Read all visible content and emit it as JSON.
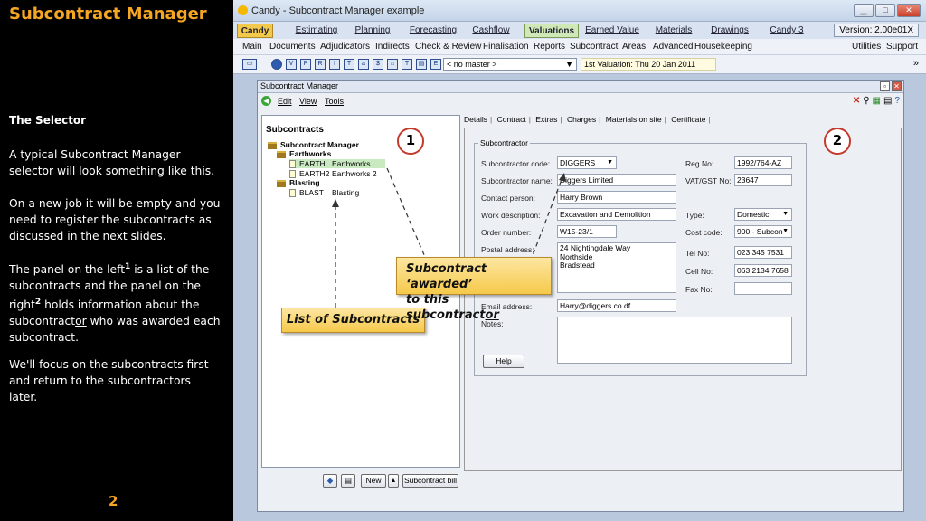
{
  "slide": {
    "title": "Subcontract Manager",
    "heading": "The Selector",
    "p1": "A typical Subcontract Manager selector will look something like this.",
    "p2": "On a new job it will be empty and you need to register the subcontracts as discussed in the next slides.",
    "p3_a": "The panel on the left",
    "p3_sup1": "1",
    "p3_b": " is a list of the subcontracts and the panel on the right",
    "p3_sup2": "2",
    "p3_c": " holds information about the subcontract",
    "p3_or": "or",
    "p3_d": " who was awarded each subcontract.",
    "p4": "We'll focus on the subcontracts first and return to the subcontractors later.",
    "page_number": "2"
  },
  "app": {
    "window_title": "Candy - Subcontract Manager example",
    "modules": [
      "Candy",
      "Estimating",
      "Planning",
      "Forecasting",
      "Cashflow",
      "Valuations",
      "Earned Value",
      "Materials",
      "Drawings",
      "Candy 3"
    ],
    "active_module": "Valuations",
    "version": "Version: 2.00e01X",
    "menu": [
      "Main",
      "Documents",
      "Adjudicators",
      "Indirects",
      "Check & Review",
      "Finalisation",
      "Reports",
      "Subcontract",
      "Areas",
      "Advanced",
      "Housekeeping"
    ],
    "menu_right": [
      "Utilities",
      "Support"
    ],
    "master_select": "< no master >",
    "valuation": "1st Valuation: Thu 20 Jan 2011"
  },
  "inner": {
    "title": "Subcontract Manager",
    "menu": [
      "Edit",
      "View",
      "Tools"
    ],
    "list_title": "Subcontracts",
    "tree": {
      "root": "Subcontract Manager",
      "group1": "Earthworks",
      "items1": [
        {
          "code": "EARTH",
          "name": "Earthworks"
        },
        {
          "code": "EARTH2",
          "name": "Earthworks 2"
        }
      ],
      "group2": "Blasting",
      "items2": [
        {
          "code": "BLAST",
          "name": "Blasting"
        }
      ]
    },
    "buttons": {
      "new": "New",
      "bill": "Subcontract bill"
    },
    "tabs": [
      "Details",
      "Contract",
      "Extras",
      "Charges",
      "Materials on site",
      "Certificate"
    ],
    "group_label": "Subcontractor",
    "fields": {
      "code_label": "Subcontractor code:",
      "code": "DIGGERS",
      "name_label": "Subcontractor name:",
      "name": "Diggers Limited",
      "contact_label": "Contact person:",
      "contact": "Harry Brown",
      "work_label": "Work description:",
      "work": "Excavation and Demolition",
      "order_label": "Order number:",
      "order": "W15-23/1",
      "postal_label": "Postal address:",
      "postal1": "24 Nightingdale Way",
      "postal2": "Northside",
      "postal3": "Bradstead",
      "email_label": "Email address:",
      "email": "Harry@diggers.co.df",
      "notes_label": "Notes:",
      "reg_label": "Reg No:",
      "reg": "1992/764-AZ",
      "vat_label": "VAT/GST No:",
      "vat": "23647",
      "type_label": "Type:",
      "type": "Domestic",
      "cost_label": "Cost code:",
      "cost": "900 - Subcon",
      "tel_label": "Tel No:",
      "tel": "023 345 7531",
      "cell_label": "Cell No:",
      "cell": "063 2134 7658",
      "fax_label": "Fax No:",
      "fax": "",
      "help": "Help"
    }
  },
  "annotations": {
    "circle1": "1",
    "circle2": "2",
    "callout_list": "List of Subcontracts",
    "callout_awarded_1": "Subcontract ‘awarded’",
    "callout_awarded_2a": "to this subcontract",
    "callout_awarded_2b": "or"
  }
}
